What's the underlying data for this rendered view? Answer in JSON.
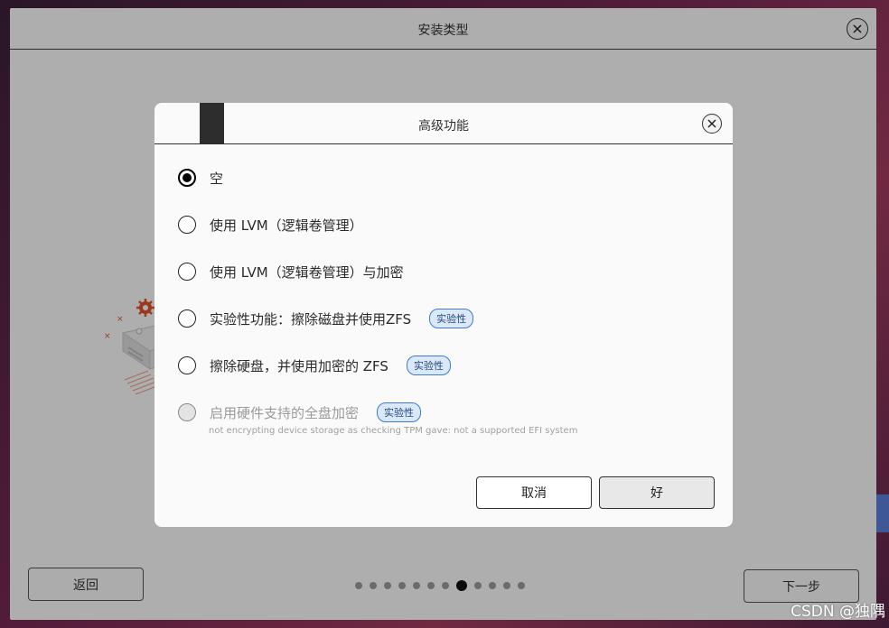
{
  "installer": {
    "title": "安装类型",
    "back_label": "返回",
    "next_label": "下一步",
    "steps_total": 12,
    "steps_current": 8
  },
  "dialog": {
    "title": "高级功能",
    "options": [
      {
        "label": "空",
        "checked": true,
        "disabled": false,
        "badge": ""
      },
      {
        "label": "使用 LVM（逻辑卷管理）",
        "checked": false,
        "disabled": false,
        "badge": ""
      },
      {
        "label": "使用 LVM（逻辑卷管理）与加密",
        "checked": false,
        "disabled": false,
        "badge": ""
      },
      {
        "label": "实验性功能：擦除磁盘并使用ZFS",
        "checked": false,
        "disabled": false,
        "badge": "实验性"
      },
      {
        "label": "擦除硬盘，并使用加密的 ZFS",
        "checked": false,
        "disabled": false,
        "badge": "实验性"
      },
      {
        "label": "启用硬件支持的全盘加密",
        "checked": false,
        "disabled": true,
        "badge": "实验性"
      }
    ],
    "tpm_note": "not encrypting device storage as checking TPM gave: not a supported EFI system",
    "cancel_label": "取消",
    "ok_label": "好"
  },
  "watermark": "CSDN @独隅",
  "colors": {
    "badge_border": "#3e7ad0",
    "badge_bg": "#dbe8f8",
    "illustration_accent": "#e0522a"
  }
}
